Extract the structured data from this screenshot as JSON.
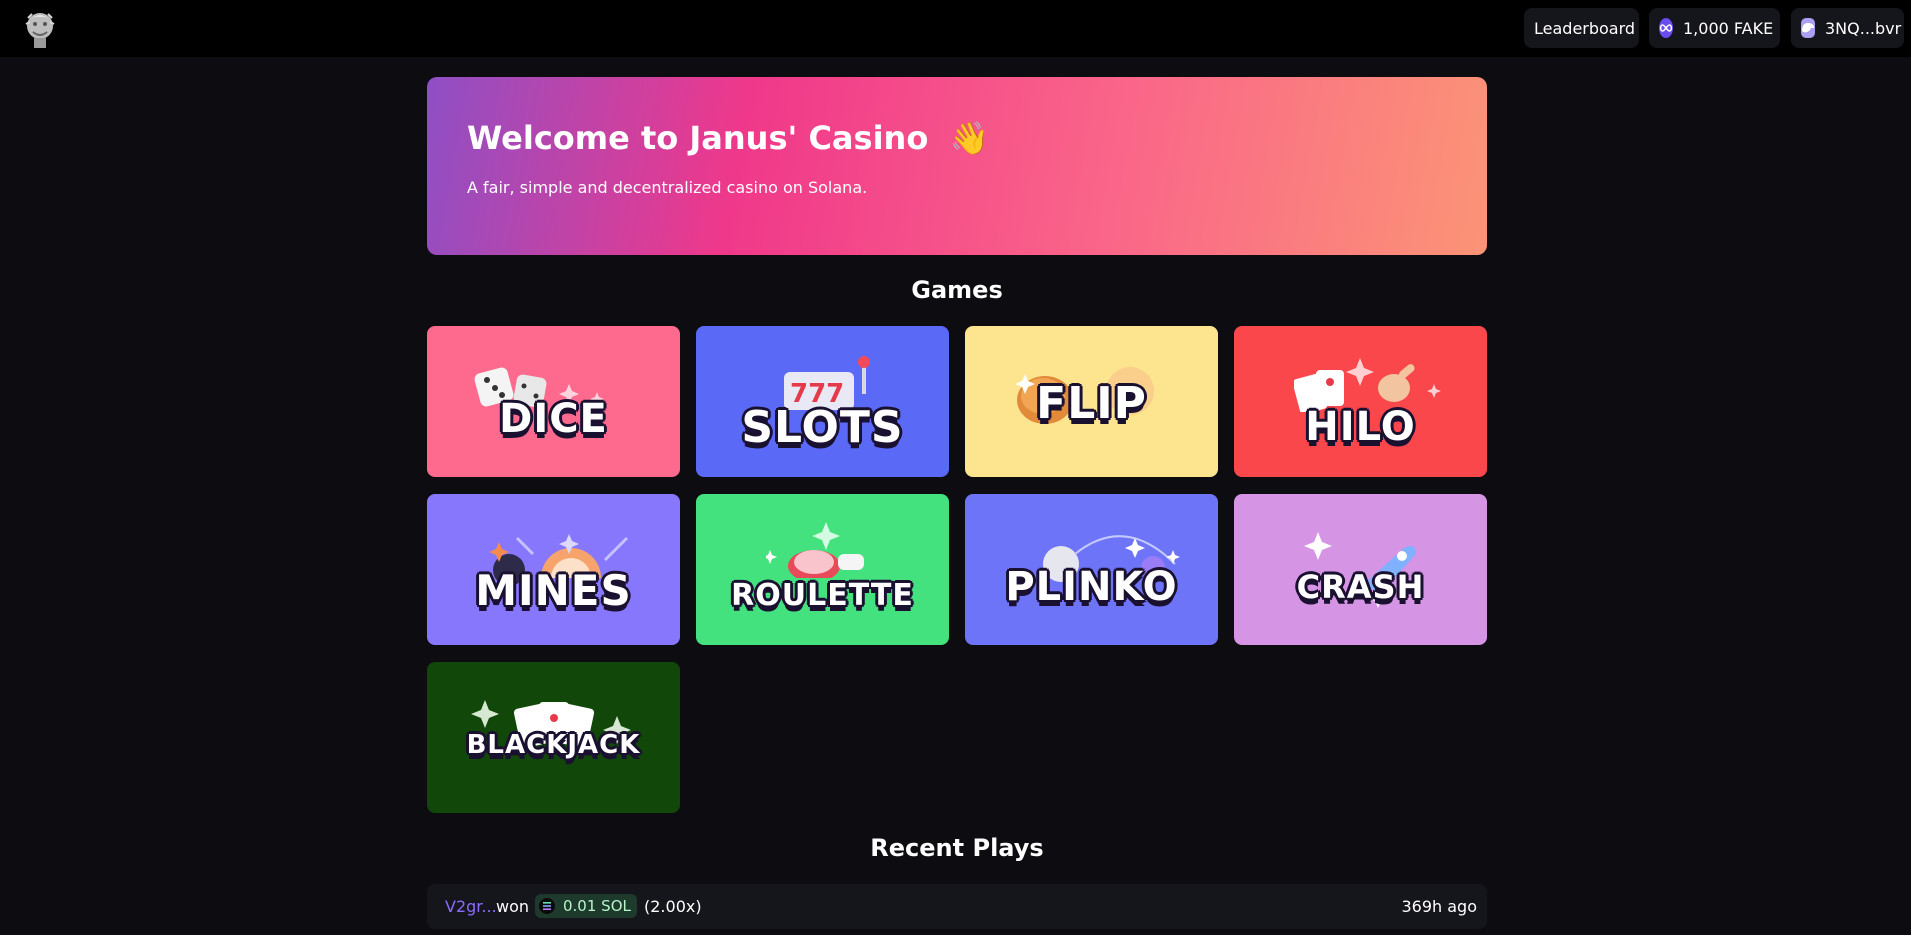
{
  "header": {
    "leaderboard_label": "Leaderboard",
    "balance_label": "1,000 FAKE",
    "wallet_label": "3NQ...bvr"
  },
  "welcome": {
    "title": "Welcome to Janus' Casino",
    "emoji": "👋",
    "subtitle": "A fair, simple and decentralized casino on Solana."
  },
  "games_section": {
    "title": "Games",
    "games": [
      {
        "label": "DICE",
        "color": "#fd6a8d"
      },
      {
        "label": "SLOTS",
        "color": "#5a6af6"
      },
      {
        "label": "FLIP",
        "color": "#fde58f"
      },
      {
        "label": "HILO",
        "color": "#f9474c"
      },
      {
        "label": "MINES",
        "color": "#8777fd"
      },
      {
        "label": "ROULETTE",
        "color": "#44e27e"
      },
      {
        "label": "PLINKO",
        "color": "#6e74f7"
      },
      {
        "label": "CRASH",
        "color": "#d694e5"
      },
      {
        "label": "BLACKJACK",
        "color": "#114709"
      }
    ]
  },
  "recent_plays": {
    "title": "Recent Plays",
    "rows": [
      {
        "user": "V2gr...",
        "result": "won",
        "amount": "0.01 SOL",
        "multiplier": "(2.00x)",
        "time": "369h ago"
      }
    ]
  },
  "icons": {
    "logo": "janus-head-logo",
    "balance": "infinity-token-icon",
    "wallet": "phantom-wallet-icon",
    "amount": "solana-icon"
  }
}
